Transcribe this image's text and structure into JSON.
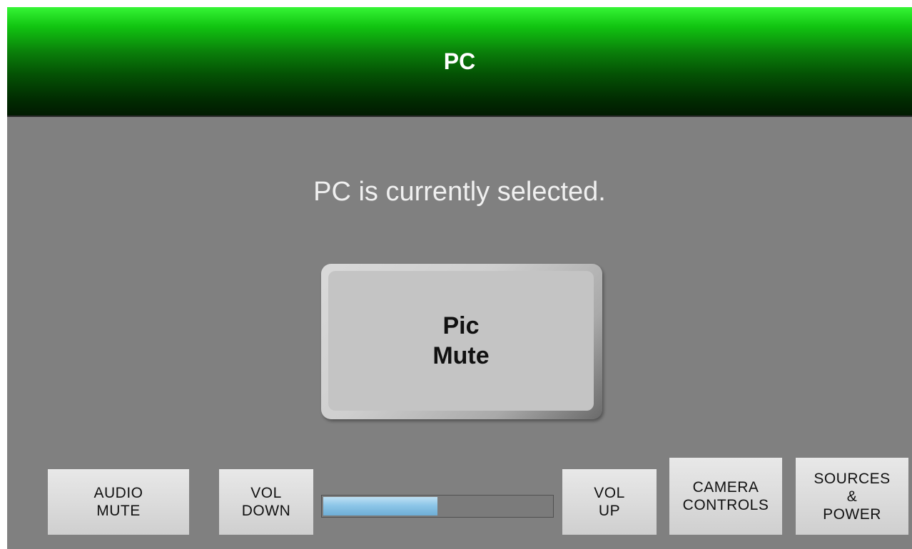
{
  "header": {
    "title": "PC"
  },
  "main": {
    "status_text": "PC is currently selected.",
    "pic_mute_label": "Pic\nMute"
  },
  "controls": {
    "audio_mute_label": "AUDIO\nMUTE",
    "vol_down_label": "VOL\nDOWN",
    "vol_up_label": "VOL\nUP",
    "camera_controls_label": "CAMERA\nCONTROLS",
    "sources_power_label": "SOURCES\n&\nPOWER",
    "volume_level": 0.5
  },
  "colors": {
    "header_green": "#0a7e0a",
    "panel_gray": "#808080",
    "volume_fill": "#8dc6e8"
  }
}
